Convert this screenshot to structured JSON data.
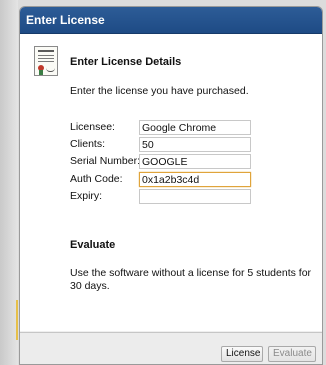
{
  "dialog": {
    "title": "Enter License"
  },
  "license_section": {
    "heading": "Enter License Details",
    "description": "Enter the license you have purchased.",
    "fields": {
      "licensee": {
        "label": "Licensee:",
        "value": "Google Chrome"
      },
      "clients": {
        "label": "Clients:",
        "value": "50"
      },
      "serial": {
        "label": "Serial Number:",
        "value": "GOOGLE"
      },
      "auth": {
        "label": "Auth Code:",
        "value": "0x1a2b3c4d"
      },
      "expiry": {
        "label": "Expiry:",
        "value": ""
      }
    }
  },
  "evaluate_section": {
    "heading": "Evaluate",
    "description": "Use the software without a license for 5 students for 30 days."
  },
  "buttons": {
    "license": "License",
    "evaluate": "Evaluate"
  },
  "colors": {
    "titlebar": "#1e4b85",
    "focus_border": "#e0a43b"
  },
  "icons": {
    "certificate": "certificate-icon"
  }
}
